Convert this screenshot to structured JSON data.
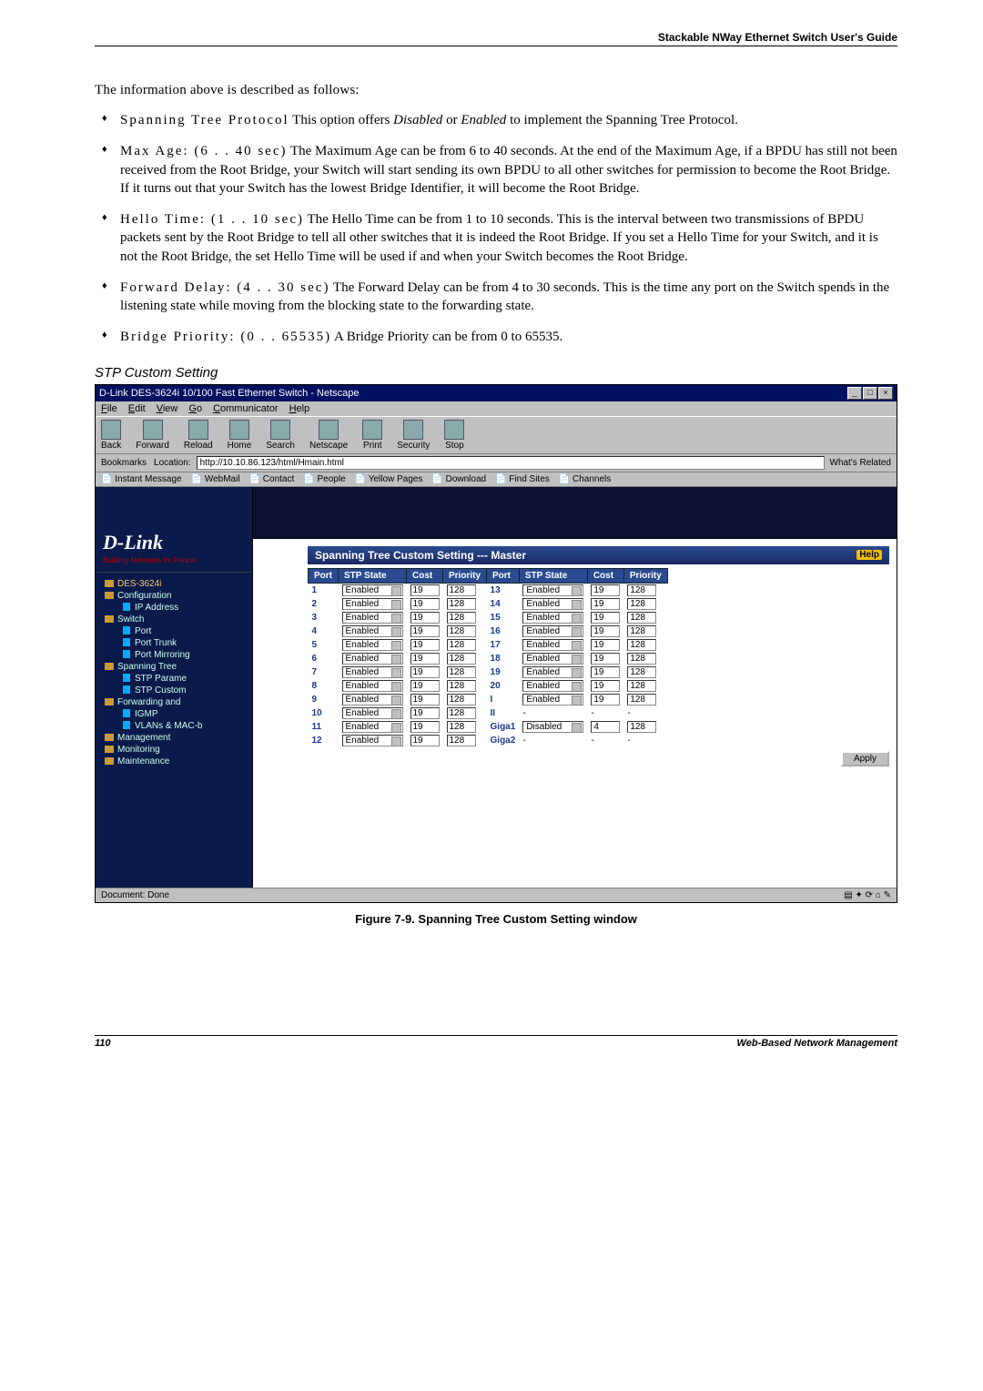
{
  "header": "Stackable NWay Ethernet Switch User's Guide",
  "intro": "The information above is described as follows:",
  "bullets": [
    {
      "term": "Spanning Tree Protocol",
      "body_a": "  This option offers ",
      "em1": "Disabled",
      "mid": " or ",
      "em2": "Enabled",
      "body_b": " to implement the Spanning Tree Protocol."
    },
    {
      "term": "Max Age: (6 . . 40 sec)",
      "body": "  The Maximum Age can be from 6 to 40 seconds. At the end of the Maximum Age, if a BPDU has still not been received from the Root Bridge, your Switch will start sending its own BPDU to all other switches for permission to become the Root Bridge. If it turns out that your Switch has the lowest Bridge Identifier, it will become the Root Bridge."
    },
    {
      "term": "Hello Time: (1 . . 10 sec)",
      "body": "  The Hello Time can be from 1 to 10 seconds. This is the interval between two transmissions of BPDU packets sent by the Root Bridge to tell all other switches that it is indeed the Root Bridge. If you set a Hello Time for your Switch, and it is not the Root Bridge, the set Hello Time will be used if and when your Switch becomes the Root Bridge."
    },
    {
      "term": "Forward Delay: (4 . . 30 sec)",
      "body": "  The Forward Delay can be from 4 to 30 seconds. This is the time any port on the Switch spends in the listening state while moving from the blocking state to the forwarding state."
    },
    {
      "term": "Bridge Priority: (0 . . 65535)",
      "body": "  A Bridge Priority can be from 0 to 65535."
    }
  ],
  "subhead": "STP Custom Setting",
  "browser": {
    "title": "D-Link DES-3624i 10/100 Fast Ethernet Switch - Netscape",
    "menu": [
      "File",
      "Edit",
      "View",
      "Go",
      "Communicator",
      "Help"
    ],
    "toolbar": [
      "Back",
      "Forward",
      "Reload",
      "Home",
      "Search",
      "Netscape",
      "Print",
      "Security",
      "Stop"
    ],
    "bookmarks_label": "Bookmarks",
    "location_label": "Location:",
    "location_value": "http://10.10.86.123/html/Hmain.html",
    "whats_related": "What's Related",
    "channels": [
      "Instant Message",
      "WebMail",
      "Contact",
      "People",
      "Yellow Pages",
      "Download",
      "Find Sites",
      "Channels"
    ],
    "status": "Document: Done"
  },
  "sidebar": {
    "logo": "D-Link",
    "logo_sub": "Building Networks for People",
    "model": "DES-3624i",
    "items": [
      "Configuration",
      "IP Address",
      "Switch",
      "Port",
      "Port Trunk",
      "Port Mirroring",
      "Spanning Tree",
      "STP Parame",
      "STP Custom",
      "Forwarding and",
      "IGMP",
      "VLANs & MAC-b",
      "Management",
      "Monitoring",
      "Maintenance"
    ]
  },
  "panel": {
    "title": "Spanning Tree Custom Setting --- Master",
    "help": "Help",
    "headers": [
      "Port",
      "STP State",
      "Cost",
      "Priority",
      "Port",
      "STP State",
      "Cost",
      "Priority"
    ],
    "rows": [
      {
        "p1": "1",
        "s1": "Enabled",
        "c1": "19",
        "r1": "128",
        "p2": "13",
        "s2": "Enabled",
        "c2": "19",
        "r2": "128"
      },
      {
        "p1": "2",
        "s1": "Enabled",
        "c1": "19",
        "r1": "128",
        "p2": "14",
        "s2": "Enabled",
        "c2": "19",
        "r2": "128"
      },
      {
        "p1": "3",
        "s1": "Enabled",
        "c1": "19",
        "r1": "128",
        "p2": "15",
        "s2": "Enabled",
        "c2": "19",
        "r2": "128"
      },
      {
        "p1": "4",
        "s1": "Enabled",
        "c1": "19",
        "r1": "128",
        "p2": "16",
        "s2": "Enabled",
        "c2": "19",
        "r2": "128"
      },
      {
        "p1": "5",
        "s1": "Enabled",
        "c1": "19",
        "r1": "128",
        "p2": "17",
        "s2": "Enabled",
        "c2": "19",
        "r2": "128"
      },
      {
        "p1": "6",
        "s1": "Enabled",
        "c1": "19",
        "r1": "128",
        "p2": "18",
        "s2": "Enabled",
        "c2": "19",
        "r2": "128"
      },
      {
        "p1": "7",
        "s1": "Enabled",
        "c1": "19",
        "r1": "128",
        "p2": "19",
        "s2": "Enabled",
        "c2": "19",
        "r2": "128"
      },
      {
        "p1": "8",
        "s1": "Enabled",
        "c1": "19",
        "r1": "128",
        "p2": "20",
        "s2": "Enabled",
        "c2": "19",
        "r2": "128"
      },
      {
        "p1": "9",
        "s1": "Enabled",
        "c1": "19",
        "r1": "128",
        "p2": "I",
        "s2": "Enabled",
        "c2": "19",
        "r2": "128"
      },
      {
        "p1": "10",
        "s1": "Enabled",
        "c1": "19",
        "r1": "128",
        "p2": "II",
        "s2": "-",
        "c2": "-",
        "r2": "-"
      },
      {
        "p1": "11",
        "s1": "Enabled",
        "c1": "19",
        "r1": "128",
        "p2": "Giga1",
        "s2": "Disabled",
        "c2": "4",
        "r2": "128"
      },
      {
        "p1": "12",
        "s1": "Enabled",
        "c1": "19",
        "r1": "128",
        "p2": "Giga2",
        "s2": "-",
        "c2": "-",
        "r2": "-"
      }
    ],
    "apply": "Apply"
  },
  "caption": "Figure 7-9.  Spanning Tree Custom Setting window",
  "footer": {
    "page": "110",
    "chapter": "Web-Based Network Management"
  }
}
